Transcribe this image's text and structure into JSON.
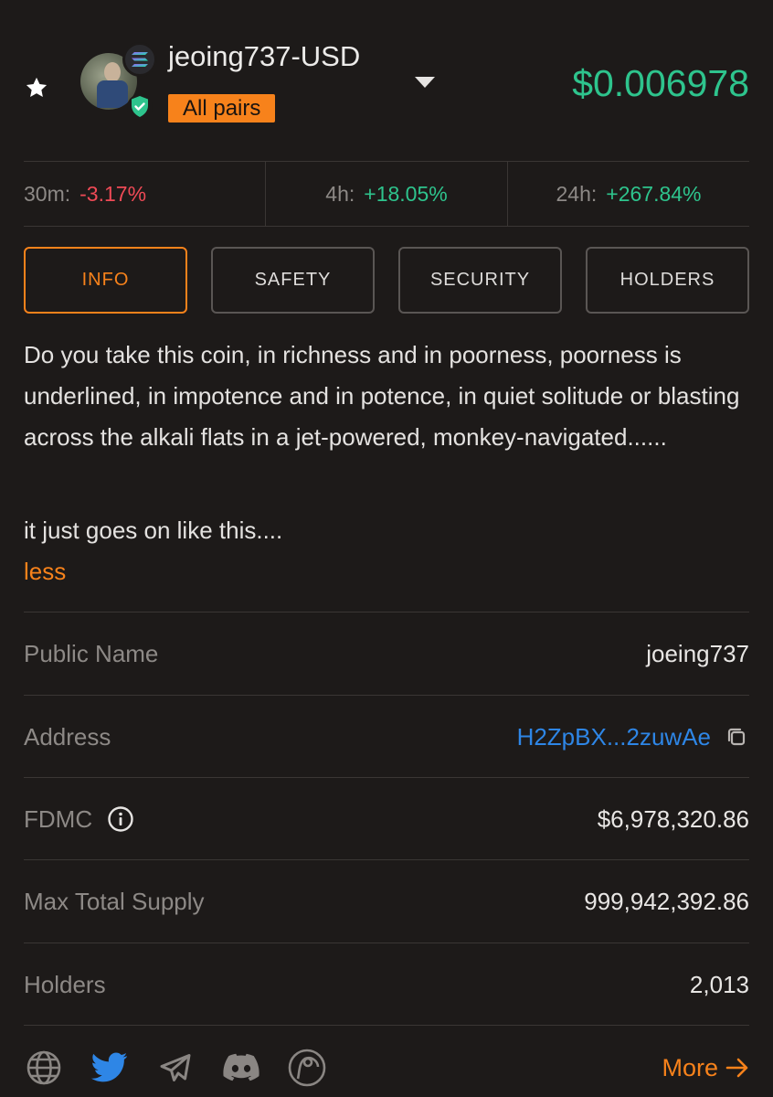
{
  "header": {
    "pair_name": "jeoing737-USD",
    "badge_label": "All pairs",
    "price": "$0.006978",
    "chain_icon": "solana-icon",
    "colors": {
      "accent": "#f7821b",
      "positive": "#2ec48d",
      "negative": "#ef4a56",
      "link": "#2e86e6"
    }
  },
  "changes": [
    {
      "label": "30m:",
      "value": "-3.17%",
      "direction": "negative"
    },
    {
      "label": "4h:",
      "value": "+18.05%",
      "direction": "positive"
    },
    {
      "label": "24h:",
      "value": "+267.84%",
      "direction": "positive"
    }
  ],
  "tabs": [
    {
      "label": "INFO",
      "active": true
    },
    {
      "label": "SAFETY",
      "active": false
    },
    {
      "label": "SECURITY",
      "active": false
    },
    {
      "label": "HOLDERS",
      "active": false
    }
  ],
  "description": {
    "text": "Do you take this coin, in richness and in poorness, poorness is underlined, in impotence and in potence, in quiet solitude or blasting across the alkali flats in a jet-powered, monkey-navigated......",
    "text2": "it just goes on like this....",
    "toggle": "less"
  },
  "details": {
    "public_name": {
      "label": "Public Name",
      "value": "joeing737"
    },
    "address": {
      "label": "Address",
      "value": "H2ZpBX...2zuwAe"
    },
    "fdmc": {
      "label": "FDMC",
      "value": "$6,978,320.86"
    },
    "max_supply": {
      "label": "Max Total Supply",
      "value": "999,942,392.86"
    },
    "holders": {
      "label": "Holders",
      "value": "2,013"
    }
  },
  "footer": {
    "icons": [
      "globe-icon",
      "twitter-icon",
      "telegram-icon",
      "discord-icon",
      "coingecko-icon"
    ],
    "more_label": "More"
  }
}
